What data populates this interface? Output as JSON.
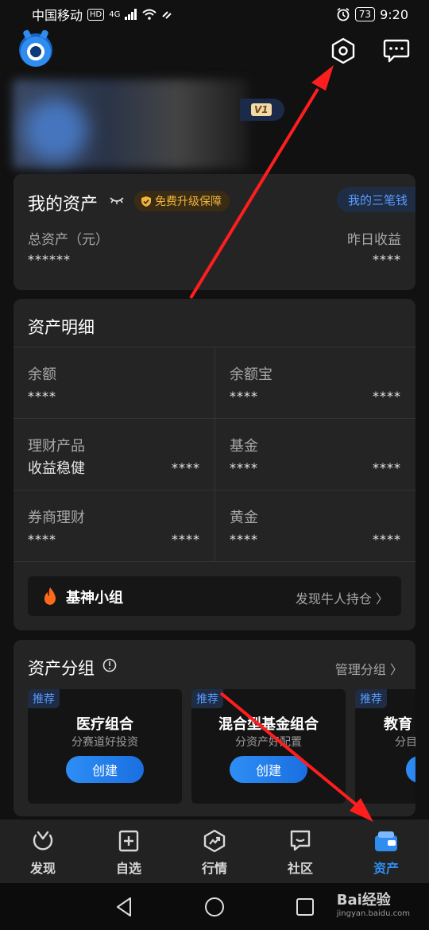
{
  "status_bar": {
    "carrier": "中国移动",
    "hd": "HD",
    "network": "4G",
    "battery": "73",
    "time": "9:20"
  },
  "header": {
    "logo_icon": "app-logo-icon",
    "settings_icon": "settings-hexagon-icon",
    "message_icon": "message-icon"
  },
  "profile": {
    "vip_level": "V1"
  },
  "my_assets": {
    "title": "我的资产",
    "protect_badge": "免费升级保障",
    "three_money": "我的三笔钱",
    "total_label": "总资产（元）",
    "total_value": "******",
    "yesterday_label": "昨日收益",
    "yesterday_value": "****"
  },
  "asset_detail": {
    "title": "资产明细",
    "cells": [
      {
        "name": "余额",
        "sub": "",
        "left": "****",
        "right": ""
      },
      {
        "name": "余额宝",
        "sub": "",
        "left": "****",
        "right": "****"
      },
      {
        "name": "理财产品",
        "sub": "收益稳健",
        "left": "",
        "right": "****"
      },
      {
        "name": "基金",
        "sub": "",
        "left": "****",
        "right": "****"
      },
      {
        "name": "券商理财",
        "sub": "",
        "left": "****",
        "right": "****"
      },
      {
        "name": "黄金",
        "sub": "",
        "left": "****",
        "right": "****"
      }
    ],
    "group": {
      "name": "基神小组",
      "link": "发现牛人持仓"
    }
  },
  "portfolio": {
    "title": "资产分组",
    "manage": "管理分组",
    "items": [
      {
        "tag": "推荐",
        "name": "医疗组合",
        "desc": "分赛道好投资",
        "button": "创建"
      },
      {
        "tag": "推荐",
        "name": "混合型基金组合",
        "desc": "分资产好配置",
        "button": "创建"
      },
      {
        "tag": "推荐",
        "name": "教育",
        "desc": "分目",
        "button": ""
      }
    ]
  },
  "bottom_nav": [
    {
      "label": "发现",
      "icon": "discover-icon",
      "active": false
    },
    {
      "label": "自选",
      "icon": "watchlist-icon",
      "active": false
    },
    {
      "label": "行情",
      "icon": "market-icon",
      "active": false
    },
    {
      "label": "社区",
      "icon": "community-icon",
      "active": false
    },
    {
      "label": "资产",
      "icon": "wallet-icon",
      "active": true
    }
  ],
  "watermark": {
    "brand": "Bai经验",
    "url": "jingyan.baidu.com"
  },
  "colors": {
    "accent": "#2f8df0",
    "background": "#111111",
    "card": "#242424",
    "annotation": "#ff1e1e"
  }
}
